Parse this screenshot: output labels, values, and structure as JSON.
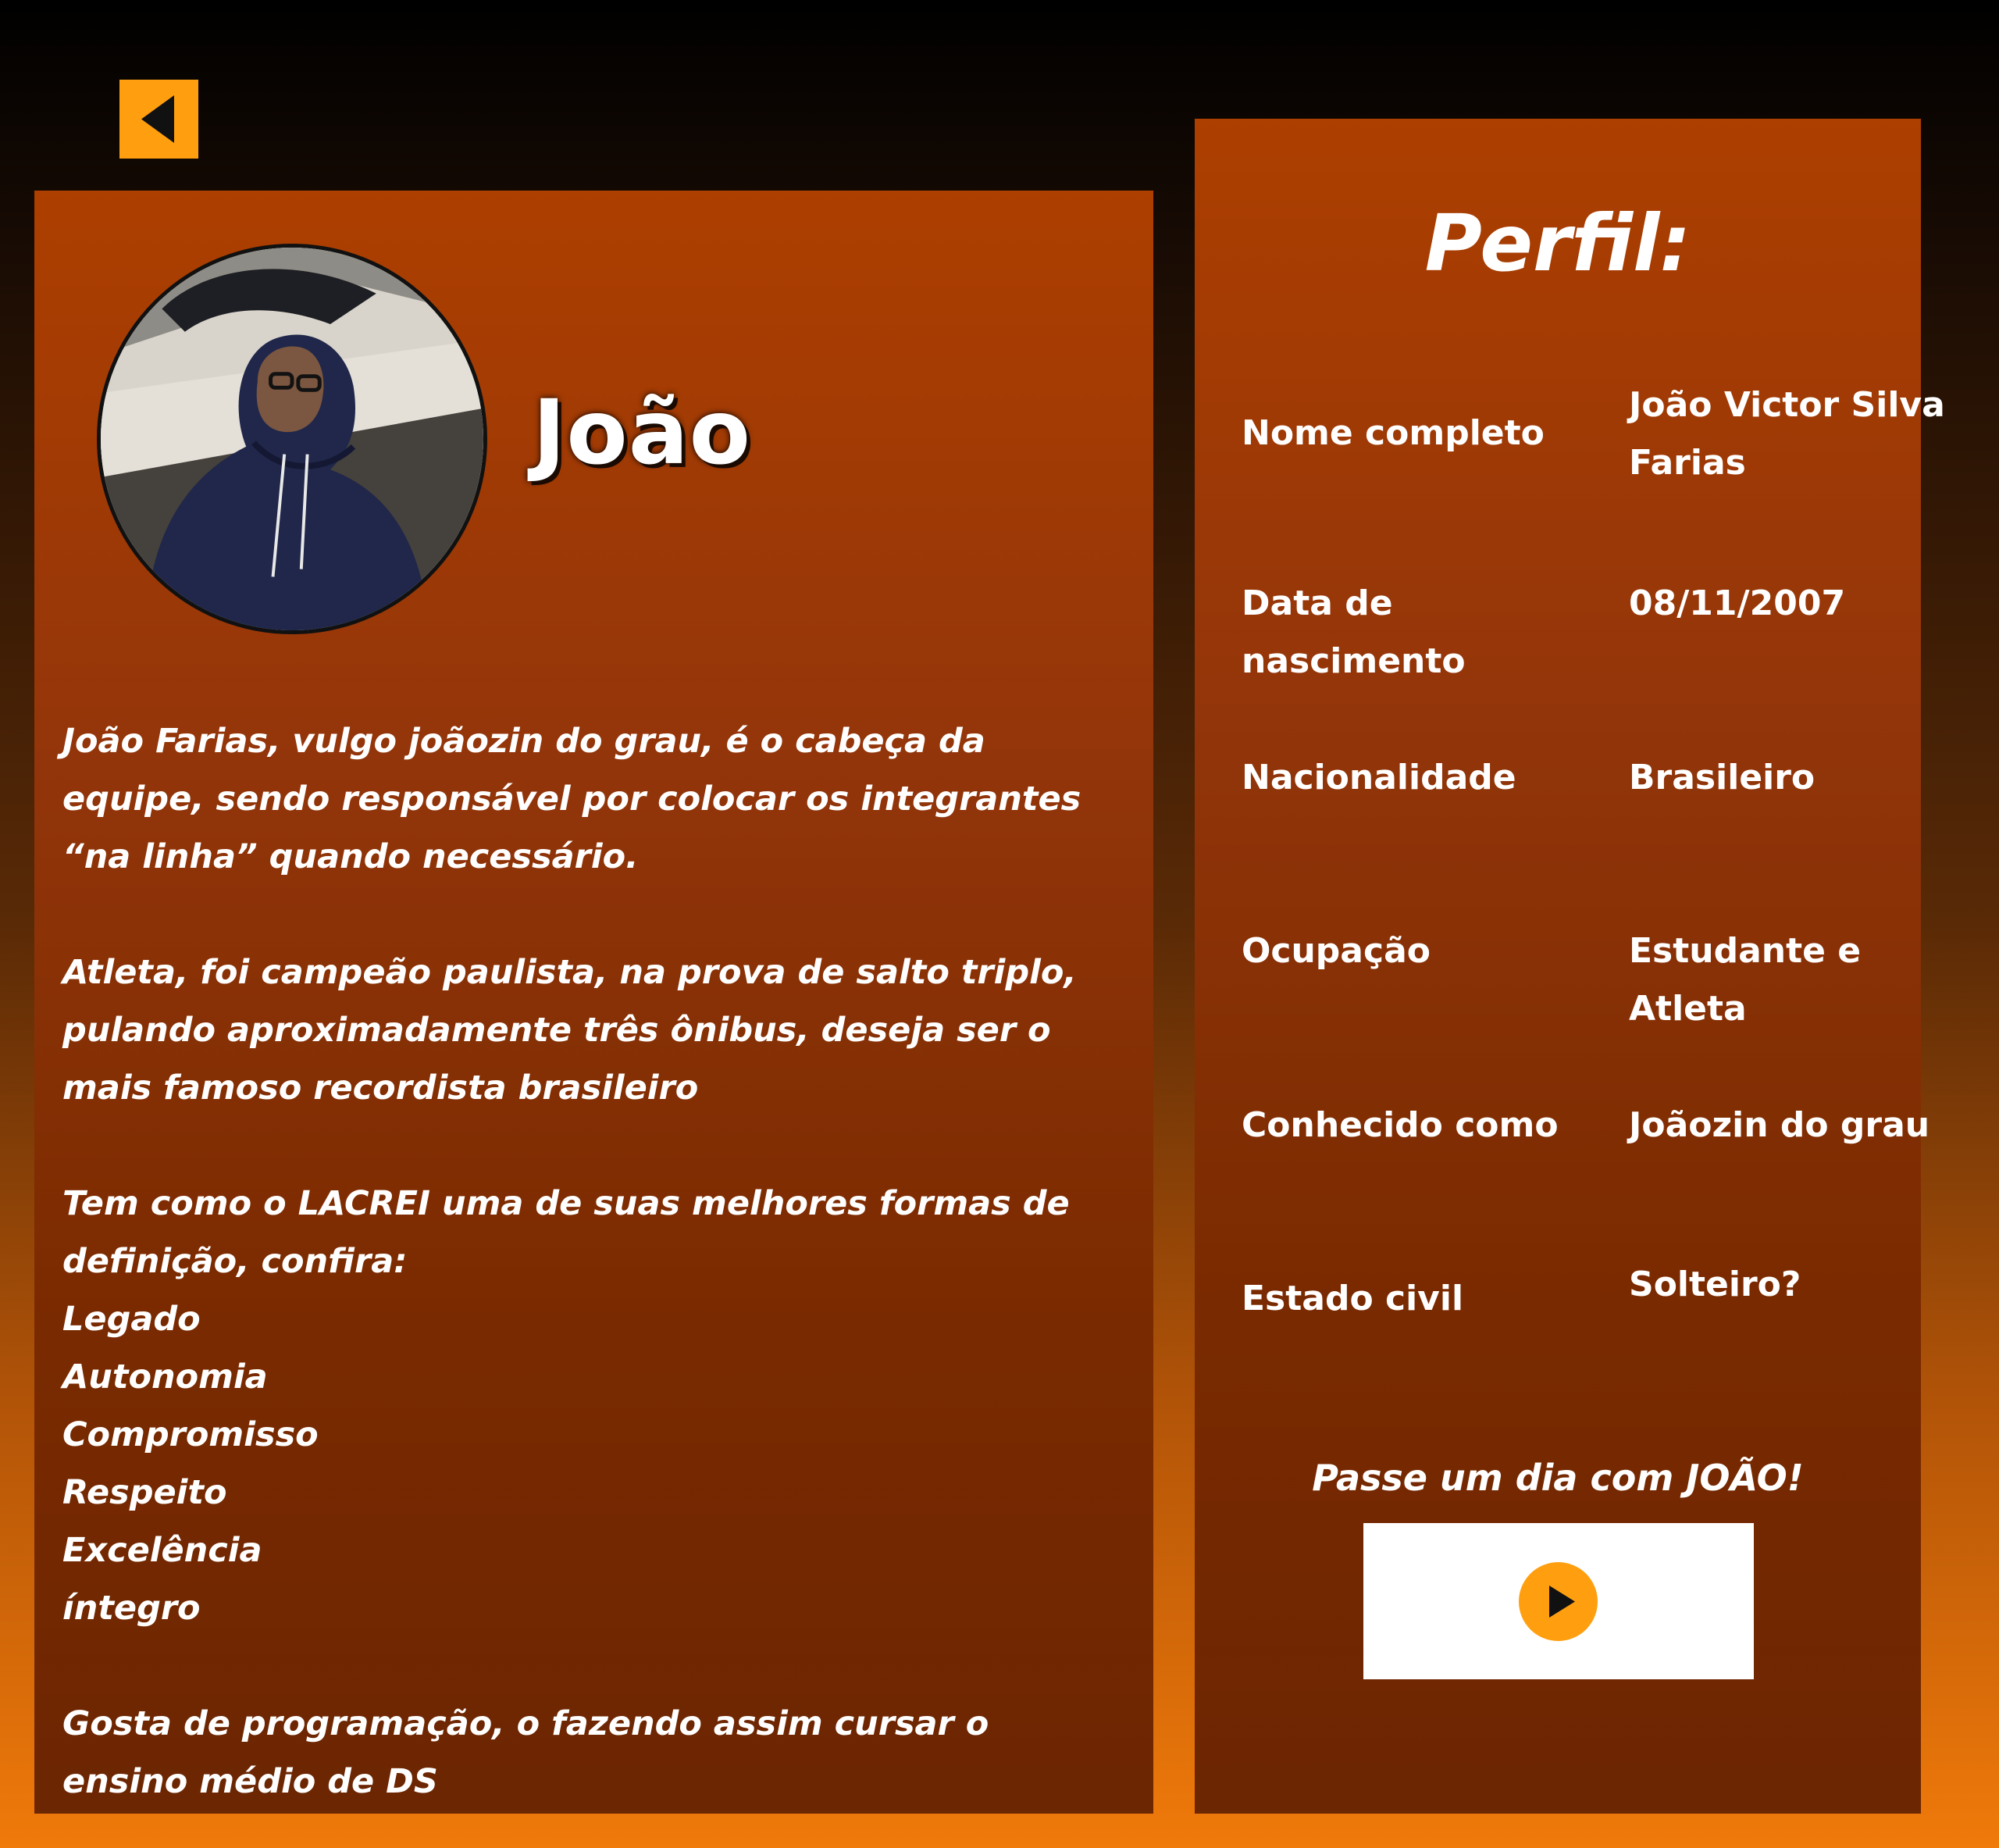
{
  "navigation": {
    "back_icon": "caret-left-icon"
  },
  "colors": {
    "accent": "#ff9f0f",
    "card_top": "#ad3f00",
    "card_bottom": "#6c2602",
    "page_bottom": "#f07a0a"
  },
  "hero": {
    "name": "João",
    "avatar_icon": "profile-photo"
  },
  "bio": {
    "paragraph_1": "João Farias, vulgo joãozin do grau, é o cabeça da equipe, sendo responsável por colocar os integrantes “na linha” quando necessário.",
    "paragraph_2": "Atleta, foi campeão paulista, na prova de salto triplo, pulando aproximadamente três ônibus, deseja ser o mais famoso recordista brasileiro",
    "paragraph_3": "Tem como o LACREI uma de suas melhores formas de definição, confira:",
    "values": [
      "Legado",
      "Autonomia",
      "Compromisso",
      "Respeito",
      "Excelência",
      "íntegro"
    ],
    "paragraph_4": "Gosta de programação, o fazendo assim cursar o ensino médio de DS"
  },
  "profile": {
    "heading": "Perfil:",
    "rows": [
      {
        "label": "Nome completo",
        "value": "João Victor Silva Farias"
      },
      {
        "label": "Data de nascimento",
        "value": "08/11/2007"
      },
      {
        "label": "Nacionalidade",
        "value": "Brasileiro"
      },
      {
        "label": "Ocupação",
        "value": "Estudante e Atleta"
      },
      {
        "label": "Conhecido como",
        "value": "Joãozin do grau"
      },
      {
        "label": "Estado civil",
        "value": "Solteiro?"
      }
    ],
    "promo": "Passe um dia com JOÃO!",
    "play_icon": "play-icon"
  }
}
